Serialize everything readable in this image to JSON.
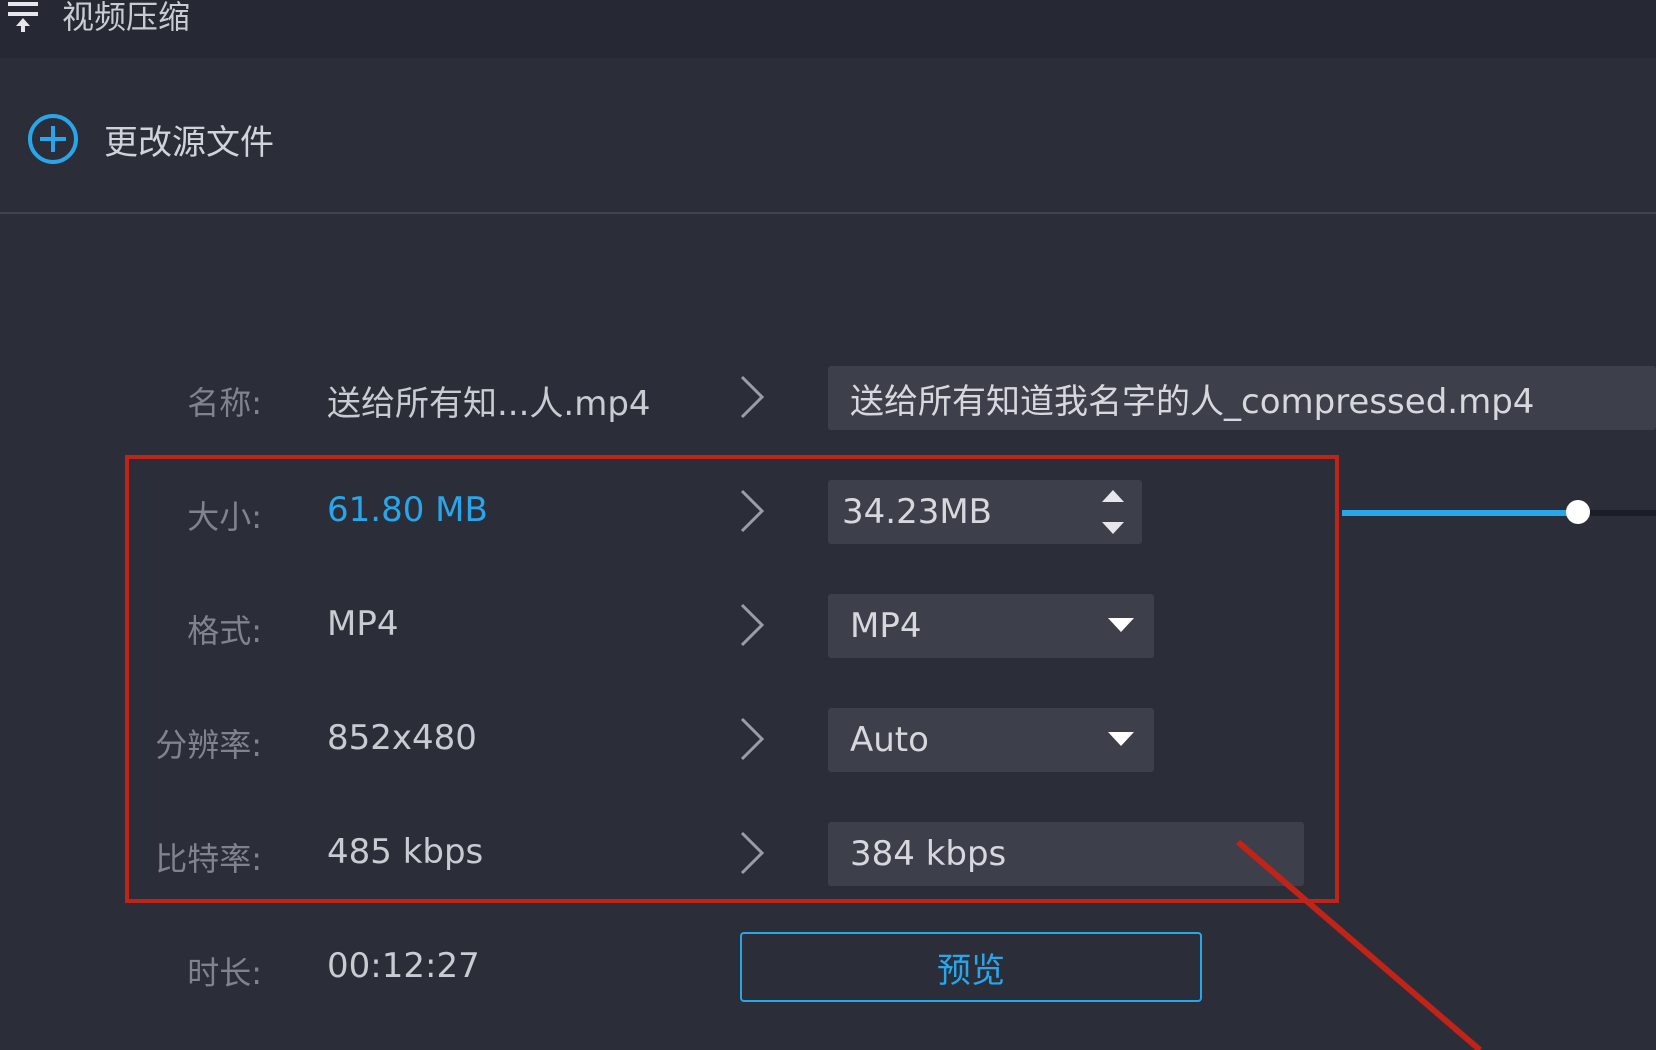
{
  "window": {
    "title": "视频压缩"
  },
  "source": {
    "change_label": "更改源文件"
  },
  "rows": {
    "name": {
      "label": "名称:",
      "source": "送给所有知...人.mp4",
      "target": "送给所有知道我名字的人_compressed.mp4"
    },
    "size": {
      "label": "大小:",
      "source": "61.80 MB",
      "target": "34.23MB",
      "slider_fraction": 0.8
    },
    "format": {
      "label": "格式:",
      "source": "MP4",
      "target": "MP4"
    },
    "resolution": {
      "label": "分辨率:",
      "source": "852x480",
      "target": "Auto"
    },
    "bitrate": {
      "label": "比特率:",
      "source": "485 kbps",
      "target": "384 kbps"
    },
    "duration": {
      "label": "时长:",
      "source": "00:12:27"
    }
  },
  "actions": {
    "preview_label": "预览"
  },
  "colors": {
    "accent": "#29a6ea",
    "highlight": "#c02318",
    "background": "#2b2d38"
  }
}
